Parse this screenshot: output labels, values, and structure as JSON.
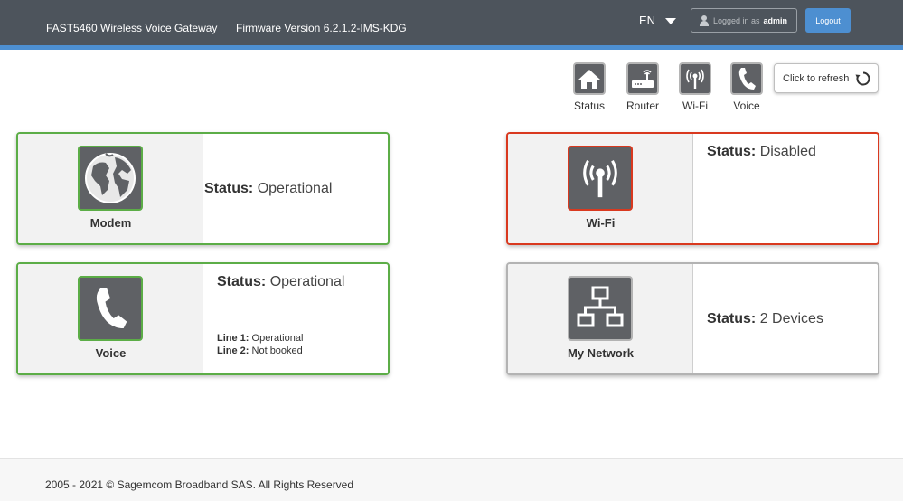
{
  "header": {
    "device_name": "FAST5460 Wireless Voice Gateway",
    "firmware": "Firmware Version 6.2.1.2-IMS-KDG",
    "language": "EN",
    "logged_in_label": "Logged in as",
    "username": "admin",
    "logout_label": "Logout"
  },
  "quick_nav": [
    {
      "label": "Status",
      "icon": "house-icon"
    },
    {
      "label": "Router",
      "icon": "router-icon"
    },
    {
      "label": "Wi-Fi",
      "icon": "wifi-antenna-icon"
    },
    {
      "label": "Voice",
      "icon": "phone-handset-icon"
    }
  ],
  "refresh_label": "Click to refresh",
  "cards": {
    "modem": {
      "title": "Modem",
      "status_key": "Status:",
      "status_value": "Operational",
      "icon": "globe-icon",
      "border_color": "#5cad47"
    },
    "voice": {
      "title": "Voice",
      "status_key": "Status:",
      "status_value": "Operational",
      "icon": "phone-handset-icon",
      "border_color": "#5cad47",
      "lines": [
        {
          "key": "Line 1:",
          "value": "Operational"
        },
        {
          "key": "Line 2:",
          "value": "Not booked"
        }
      ]
    },
    "wifi": {
      "title": "Wi-Fi",
      "status_key": "Status:",
      "status_value": "Disabled",
      "icon": "wifi-antenna-icon",
      "border_color": "#d9391f"
    },
    "network": {
      "title": "My Network",
      "status_key": "Status:",
      "status_value": "2 Devices",
      "icon": "network-tree-icon",
      "border_color": "#b3b3b3"
    }
  },
  "footer": {
    "copyright": "2005 - 2021 © Sagemcom Broadband SAS. All Rights Reserved"
  }
}
